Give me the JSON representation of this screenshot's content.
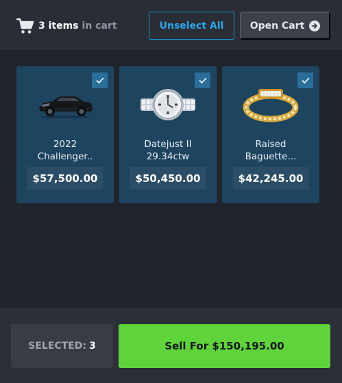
{
  "header": {
    "cart_icon": "cart-icon",
    "item_count": "3 items",
    "item_suffix": "in cart",
    "unselect_label": "Unselect All",
    "open_cart_label": "Open Cart",
    "open_cart_icon": "arrow-right-circle-icon"
  },
  "items": [
    {
      "name_line1": "2022",
      "name_line2": "Challenger..",
      "price": "$57,500.00",
      "image": "black-muscle-car",
      "selected": true
    },
    {
      "name_line1": "Datejust II",
      "name_line2": "29.34ctw",
      "price": "$50,450.00",
      "image": "iced-out-watch",
      "selected": true
    },
    {
      "name_line1": "Raised",
      "name_line2": "Baguette...",
      "price": "$42,245.00",
      "image": "gold-cuban-bracelet",
      "selected": true
    }
  ],
  "footer": {
    "selected_label": "SELECTED:",
    "selected_count": "3",
    "sell_label": "Sell For $150,195.00"
  },
  "colors": {
    "background": "#20242c",
    "card": "#1e4560",
    "accent_blue": "#2aa7e6",
    "sell_green": "#5fd43a"
  }
}
